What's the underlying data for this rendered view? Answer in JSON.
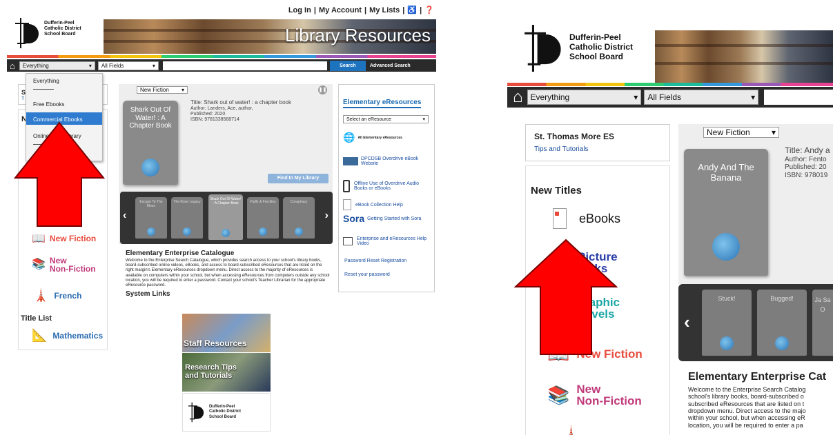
{
  "left": {
    "toplinks": {
      "login": "Log In",
      "account": "My Account",
      "lists": "My Lists"
    },
    "logo": {
      "line1": "Dufferin-Peel",
      "line2": "Catholic District",
      "line3": "School Board"
    },
    "banner_title": "Library Resources",
    "search": {
      "scope": "Everything",
      "field": "All Fields",
      "button": "Search",
      "advanced": "Advanced Search"
    },
    "dropdown": [
      "Everything",
      "Free Ebooks",
      "Commercial Ebooks",
      "Online Video library"
    ],
    "sidebar": {
      "frag1": "S",
      "frag2": "T",
      "frag3": "N",
      "new_fiction": "New Fiction",
      "new_nonfiction_1": "New",
      "new_nonfiction_2": "Non-Fiction",
      "french": "French",
      "title_list": "Title List",
      "mathematics": "Mathematics"
    },
    "featured": {
      "select": "New Fiction",
      "cover": "Shark Out Of Water! : A Chapter Book",
      "title": "Title: Shark out of water! : a chapter book",
      "author": "Author: Landers, Ace, author,",
      "published": "Published: 2020",
      "isbn": "ISBN: 9781338568714",
      "find": "Find In My Library",
      "carousel": [
        "Escape To The Moon",
        "The Rose Legacy",
        "Shark Out Of Water! : A Chapter Book",
        "Fluffy & Freckles",
        "Conspiracy"
      ]
    },
    "catalogue": {
      "heading": "Elementary Enterprise Catalogue",
      "body": "Welcome to the Enterprise Search Catalogue, which provides search access to your school's library books, board-subscribed online videos, eBooks, and access to board-subscribed eResources that are listed on the right margin's Elementary eResources dropdown menu. Direct access to the majority of eResources is available on computers within your school, but when accessing eResources from computers outside any school location, you will be required to enter a password. Contact your school's Teacher Librarian for the appropriate eResource password.",
      "system_links": "System Links",
      "tile1": "Staff Resources",
      "tile2": "Research Tips and Tutorials",
      "tile3_l1": "Dufferin-Peel",
      "tile3_l2": "Catholic District",
      "tile3_l3": "School Board"
    },
    "eresources": {
      "heading": "Elementary eResources",
      "select": "Select an eResource",
      "items": [
        "All Elementary eResources",
        "DPCDSB Overdrive eBook Website",
        "Offline Use of Overdrive Audio Books or eBooks",
        "eBook Collection Help",
        "Getting Started with Sora",
        "Enterprise and eResources Help Video"
      ],
      "sora": "Sora",
      "password_reset": "Password Reset Registration",
      "reset": "Reset your password"
    }
  },
  "right": {
    "logo": {
      "line1": "Dufferin-Peel",
      "line2": "Catholic District",
      "line3": "School Board"
    },
    "search": {
      "scope": "Everything",
      "field": "All Fields"
    },
    "school": {
      "name": "St. Thomas More ES",
      "tips": "Tips and Tutorials"
    },
    "new_titles": "New Titles",
    "categories": {
      "ebooks": "eBooks",
      "picture_books_1": "Picture",
      "picture_books_2": "oks",
      "graphic_1": "raphic",
      "graphic_2": "ovels",
      "new_fiction": "New Fiction",
      "new_nonfiction_1": "New",
      "new_nonfiction_2": "Non-Fiction"
    },
    "featured": {
      "select": "New Fiction",
      "cover": "Andy And The Banana",
      "title": "Title: Andy a",
      "author": "Author: Fento",
      "published": "Published: 20",
      "isbn": "ISBN: 978019",
      "carousel": [
        "Stuck!",
        "Bugged!",
        "Ja Sa O"
      ]
    },
    "catalogue": {
      "heading": "Elementary Enterprise Cat",
      "lines": [
        "Welcome to the Enterprise Search Catalog",
        "school's library books, board-subscribed o",
        "subscribed eResources that are listed on t",
        "dropdown menu. Direct access to the majo",
        "within your school, but when accessing eR",
        "location, you will be required to enter a pa"
      ]
    }
  },
  "colors": {
    "arrow": "#ff0000",
    "search_blue": "#1e73be",
    "link": "#1a4ea0",
    "fiction": "#e84b3c",
    "nonfiction": "#c0397a",
    "french": "#2b6cb0",
    "graphic": "#1aa5a5",
    "bar": "#2a2a2a"
  }
}
